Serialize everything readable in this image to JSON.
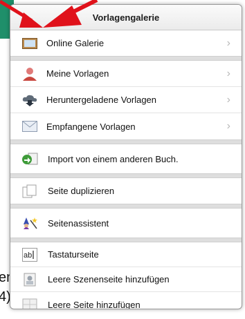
{
  "background": {
    "partial_text_1": "en",
    "partial_text_2": "4)"
  },
  "popover": {
    "title": "Vorlagengalerie",
    "sections": [
      {
        "items": [
          {
            "label": "Online Galerie",
            "icon": "picture-frame-icon",
            "chevron": true
          }
        ]
      },
      {
        "items": [
          {
            "label": "Meine Vorlagen",
            "icon": "user-icon",
            "chevron": true
          },
          {
            "label": "Heruntergeladene Vorlagen",
            "icon": "cloud-download-icon",
            "chevron": true
          },
          {
            "label": "Empfangene Vorlagen",
            "icon": "envelope-icon",
            "chevron": true
          }
        ]
      },
      {
        "items": [
          {
            "label": "Import von einem anderen Buch.",
            "icon": "import-book-icon",
            "chevron": false
          }
        ]
      },
      {
        "items": [
          {
            "label": "Seite duplizieren",
            "icon": "duplicate-page-icon",
            "chevron": false
          }
        ]
      },
      {
        "items": [
          {
            "label": "Seitenassistent",
            "icon": "wizard-icon",
            "chevron": false
          }
        ]
      },
      {
        "items": [
          {
            "label": "Tastaturseite",
            "icon": "keyboard-text-icon",
            "chevron": false
          },
          {
            "label": "Leere Szenenseite hinzufügen",
            "icon": "scene-page-icon",
            "chevron": false
          },
          {
            "label": "Leere Seite hinzufügen",
            "icon": "blank-page-icon",
            "chevron": false
          }
        ]
      }
    ]
  },
  "colors": {
    "arrow": "#e0121b",
    "background_tab": "#1f8f6a"
  }
}
